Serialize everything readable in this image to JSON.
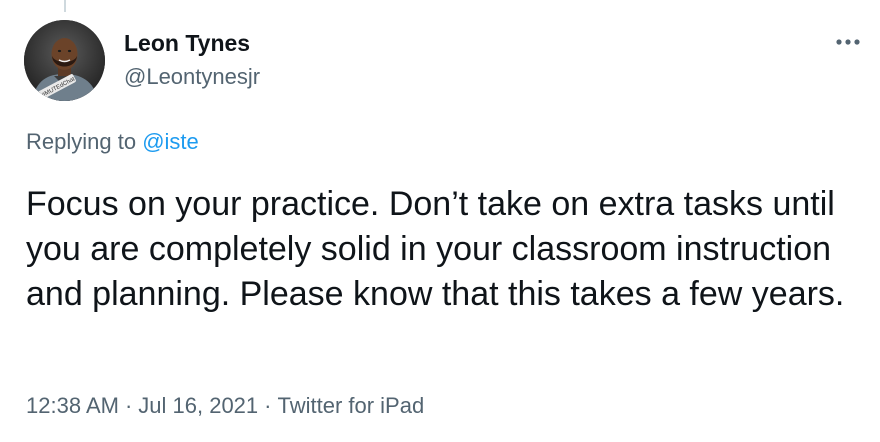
{
  "tweet": {
    "author": {
      "display_name": "Leon Tynes",
      "handle": "@Leontynesjr",
      "avatar_caption": "#MUTEdChat"
    },
    "more_icon": "ellipsis-horizontal-icon",
    "replying_prefix": "Replying to",
    "replying_to": "@iste",
    "text": "Focus on your practice. Don’t take on extra tasks until you are completely solid in your classroom instruction and planning. Please know that this takes a few years.",
    "time": "12:38 AM",
    "date": "Jul 16, 2021",
    "separator": "·",
    "source": "Twitter for iPad"
  },
  "colors": {
    "text_primary": "#0f1419",
    "text_secondary": "#536471",
    "link": "#1d9bf0",
    "thread_line": "#cfd9de"
  }
}
